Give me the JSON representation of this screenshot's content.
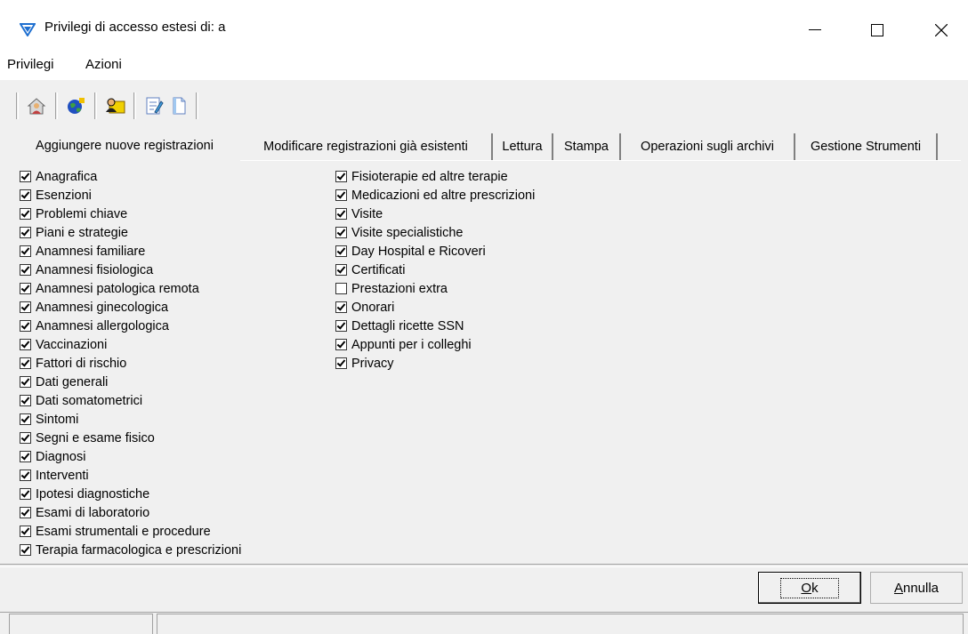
{
  "window": {
    "title": "Privilegi di accesso estesi di: a",
    "minimize_glyph": "—",
    "maximize_glyph": "☐",
    "close_glyph": "✕"
  },
  "menu": {
    "items": [
      "Privilegi",
      "Azioni"
    ]
  },
  "toolbar": {
    "buttons": [
      "home-person-icon",
      "globe-icon",
      "user-folder-icon",
      "edit-note-icon",
      "document-icon"
    ]
  },
  "tabs": {
    "items": [
      "Aggiungere nuove registrazioni",
      "Modificare registrazioni già esistenti",
      "Lettura",
      "Stampa",
      "Operazioni sugli archivi",
      "Gestione Strumenti"
    ],
    "active_index": 0
  },
  "permissions": {
    "column1": [
      {
        "label": "Anagrafica",
        "checked": true
      },
      {
        "label": "Esenzioni",
        "checked": true
      },
      {
        "label": "Problemi chiave",
        "checked": true
      },
      {
        "label": "Piani e strategie",
        "checked": true
      },
      {
        "label": "Anamnesi familiare",
        "checked": true
      },
      {
        "label": "Anamnesi fisiologica",
        "checked": true
      },
      {
        "label": "Anamnesi patologica remota",
        "checked": true
      },
      {
        "label": "Anamnesi ginecologica",
        "checked": true
      },
      {
        "label": "Anamnesi allergologica",
        "checked": true
      },
      {
        "label": "Vaccinazioni",
        "checked": true
      },
      {
        "label": "Fattori di rischio",
        "checked": true
      },
      {
        "label": "Dati generali",
        "checked": true
      },
      {
        "label": "Dati somatometrici",
        "checked": true
      },
      {
        "label": "Sintomi",
        "checked": true
      },
      {
        "label": "Segni e esame fisico",
        "checked": true
      },
      {
        "label": "Diagnosi",
        "checked": true
      },
      {
        "label": "Interventi",
        "checked": true
      },
      {
        "label": "Ipotesi diagnostiche",
        "checked": true
      },
      {
        "label": "Esami di laboratorio",
        "checked": true
      },
      {
        "label": "Esami strumentali e procedure",
        "checked": true
      },
      {
        "label": "Terapia farmacologica e prescrizioni",
        "checked": true
      }
    ],
    "column2": [
      {
        "label": "Fisioterapie ed altre terapie",
        "checked": true
      },
      {
        "label": "Medicazioni ed altre prescrizioni",
        "checked": true
      },
      {
        "label": "Visite",
        "checked": true
      },
      {
        "label": "Visite specialistiche",
        "checked": true
      },
      {
        "label": "Day Hospital e Ricoveri",
        "checked": true
      },
      {
        "label": "Certificati",
        "checked": true
      },
      {
        "label": "Prestazioni extra",
        "checked": false
      },
      {
        "label": "Onorari",
        "checked": true
      },
      {
        "label": "Dettagli ricette SSN",
        "checked": true
      },
      {
        "label": "Appunti per i colleghi",
        "checked": true
      },
      {
        "label": "Privacy",
        "checked": true
      }
    ]
  },
  "buttons": {
    "ok": "Ok",
    "cancel": "Annulla"
  },
  "colors": {
    "accent": "#1e6fd0",
    "window_bg": "#f0f0f0"
  }
}
